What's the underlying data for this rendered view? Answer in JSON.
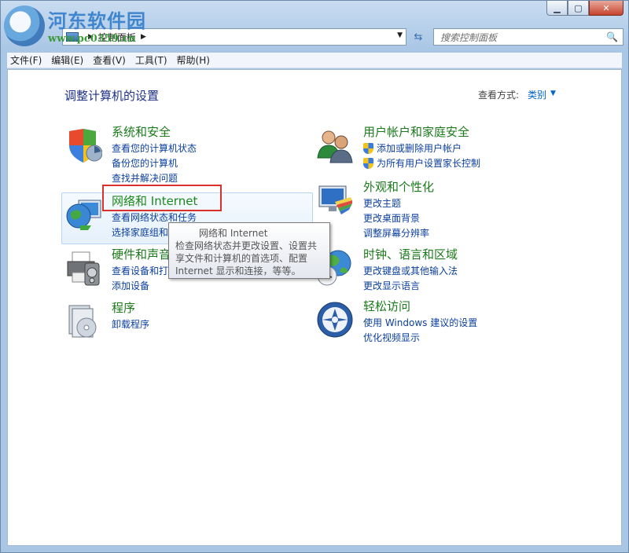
{
  "window": {
    "caption_min": "▁",
    "caption_max": "▢",
    "caption_close": "✕"
  },
  "watermark": {
    "title": "河东软件园",
    "url": "www.pc0359.cn"
  },
  "address": {
    "breadcrumb": "控制面板",
    "search_placeholder": "搜索控制面板"
  },
  "menu": [
    "文件(F)",
    "编辑(E)",
    "查看(V)",
    "工具(T)",
    "帮助(H)"
  ],
  "page": {
    "title": "调整计算机的设置",
    "viewby_label": "查看方式:",
    "viewby_value": "类别"
  },
  "categories": {
    "system": {
      "title": "系统和安全",
      "links": [
        "查看您的计算机状态",
        "备份您的计算机",
        "查找并解决问题"
      ]
    },
    "network": {
      "title": "网络和 Internet",
      "links": [
        "查看网络状态和任务",
        "选择家庭组和共享选项"
      ]
    },
    "hardware": {
      "title": "硬件和声音",
      "links": [
        "查看设备和打印机",
        "添加设备"
      ]
    },
    "programs": {
      "title": "程序",
      "links": [
        "卸载程序"
      ]
    },
    "users": {
      "title": "用户帐户和家庭安全",
      "links": [
        "添加或删除用户帐户",
        "为所有用户设置家长控制"
      ]
    },
    "appearance": {
      "title": "外观和个性化",
      "links": [
        "更改主题",
        "更改桌面背景",
        "调整屏幕分辨率"
      ]
    },
    "clock": {
      "title": "时钟、语言和区域",
      "links": [
        "更改键盘或其他输入法",
        "更改显示语言"
      ]
    },
    "ease": {
      "title": "轻松访问",
      "links": [
        "使用 Windows 建议的设置",
        "优化视频显示"
      ]
    }
  },
  "tooltip": {
    "title": "网络和 Internet",
    "body": "检查网络状态并更改设置、设置共享文件和计算机的首选项、配置 Internet 显示和连接，等等。"
  },
  "colors": {
    "category_title": "#1a7a1a",
    "link": "#0b3f9f",
    "highlight": "#d9302c"
  }
}
